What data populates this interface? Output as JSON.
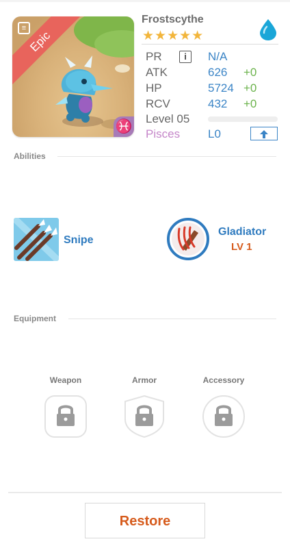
{
  "monster": {
    "name": "Frostscythe",
    "rarity": "Epic",
    "stars": "★★★★★",
    "star_count": 5,
    "element": "water-drop-icon",
    "zodiac_symbol": "♓",
    "zodiac_name": "Pisces",
    "zodiac_level": "L0",
    "level_label": "Level 05",
    "level_progress": 0
  },
  "stats": {
    "pr_label": "PR",
    "pr_value": "N/A",
    "info_glyph": "i",
    "atk_label": "ATK",
    "atk_value": "626",
    "atk_bonus": "+0",
    "hp_label": "HP",
    "hp_value": "5724",
    "hp_bonus": "+0",
    "rcv_label": "RCV",
    "rcv_value": "432",
    "rcv_bonus": "+0"
  },
  "abilities": {
    "title": "Abilities",
    "items": [
      {
        "name": "Snipe",
        "icon": "arrows-icon"
      },
      {
        "name": "Gladiator",
        "level": "LV 1",
        "icon": "claw-slash-icon"
      }
    ]
  },
  "equipment": {
    "title": "Equipment",
    "slots": [
      {
        "label": "Weapon",
        "icon": "lock-icon"
      },
      {
        "label": "Armor",
        "icon": "lock-icon"
      },
      {
        "label": "Accessory",
        "icon": "lock-icon"
      }
    ]
  },
  "actions": {
    "restore_label": "Restore"
  },
  "colors": {
    "accent_blue": "#3a84c6",
    "bonus_green": "#6ab24a",
    "epic_red": "#e8645c",
    "zodiac_purple": "#c586c9",
    "action_orange": "#d65b1c"
  }
}
